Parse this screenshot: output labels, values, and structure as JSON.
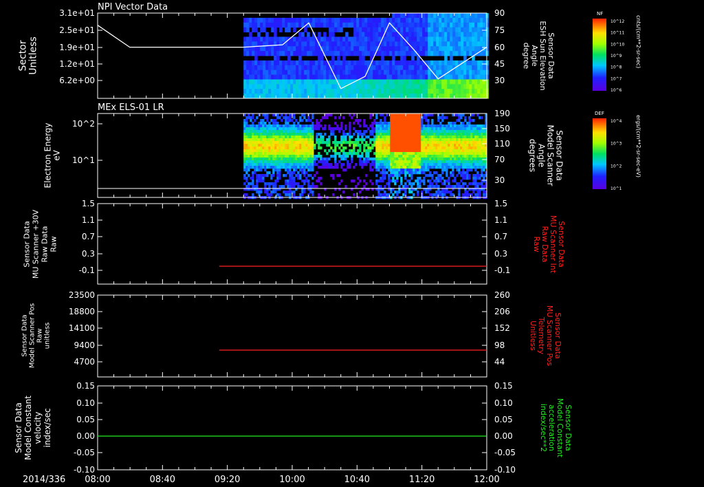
{
  "colors": {
    "bg": "#000000",
    "axis": "#ffffff",
    "red": "#ff2020",
    "green": "#22ee22"
  },
  "time_axis": {
    "date_label": "2014/336",
    "ticks": [
      "08:00",
      "08:40",
      "09:20",
      "10:00",
      "10:40",
      "11:20",
      "12:00"
    ]
  },
  "colorbars": [
    {
      "label": "NF",
      "unit": "cnts/(cm**2-sr-sec)",
      "tick_labels": [
        "10^12",
        "10^11",
        "10^10",
        "10^9",
        "10^8",
        "10^7",
        "10^6"
      ]
    },
    {
      "label": "DEF",
      "unit": "ergs/(cm**2-sr-sec-eV)",
      "tick_labels": [
        "10^4",
        "10^3",
        "10^2",
        "10^1"
      ]
    }
  ],
  "chart_data": [
    {
      "type": "heatmap",
      "title": "NPI Vector Data",
      "ylabel_lines": [
        "Sector",
        "Unitless"
      ],
      "y_ticks": [
        "3.1e+01",
        "2.5e+01",
        "1.9e+01",
        "1.2e+01",
        "6.2e+00"
      ],
      "y2label_lines": [
        "Sensor Data",
        "ESH Sun Elevation",
        "Angle",
        "degree"
      ],
      "y2_ticks": [
        "90",
        "75",
        "60",
        "45",
        "30"
      ],
      "data_start": "09:30",
      "overlay_line": {
        "name": "ESH Sun Elevation Angle",
        "t": [
          8.0,
          8.33,
          9.0,
          9.5,
          9.9,
          10.17,
          10.5,
          10.75,
          11.0,
          11.25,
          11.5,
          12.0
        ],
        "v": [
          80,
          62,
          62,
          62,
          64,
          82,
          28,
          38,
          82,
          60,
          36,
          62
        ]
      }
    },
    {
      "type": "heatmap",
      "title": "MEx ELS-01 LR",
      "ylabel_lines": [
        "Electron Energy",
        "eV"
      ],
      "y_ticks": [
        "10^2",
        "10^1"
      ],
      "y2label_lines": [
        "Sensor Data",
        "Model Scanner",
        "Angle",
        "degrees"
      ],
      "y2_ticks": [
        "190",
        "150",
        "110",
        "70",
        "30"
      ],
      "data_start": "09:30",
      "overlay_line": {
        "name": "Model Scanner Angle",
        "t": [
          8.0,
          12.0
        ],
        "v": [
          12,
          12
        ]
      }
    },
    {
      "type": "line",
      "ylabel_lines": [
        "Sensor Data",
        "MU Scanner +30V",
        "Raw Data",
        "Raw"
      ],
      "y_ticks": [
        "1.5",
        "1.1",
        "0.7",
        "0.3",
        "-0.1"
      ],
      "y2label_lines": [
        "Sensor Data",
        "MU Scanner Int",
        "Raw Data",
        "Raw"
      ],
      "y2_ticks": [
        "1.5",
        "1.1",
        "0.7",
        "0.3",
        "-0.1"
      ],
      "series": [
        {
          "t": [
            9.25,
            12.0
          ],
          "v": [
            0.0,
            0.0
          ]
        }
      ]
    },
    {
      "type": "line",
      "ylabel_lines": [
        "Sensor Data",
        "Model Scanner Pos",
        "Raw",
        "unitless"
      ],
      "y_ticks": [
        "23500",
        "18800",
        "14100",
        "9400",
        "4700"
      ],
      "y2label_lines": [
        "Sensor Data",
        "MU Scanner Pos",
        "Telemetry",
        "Unitless"
      ],
      "y2_ticks": [
        "260",
        "206",
        "152",
        "98",
        "44"
      ],
      "series": [
        {
          "t": [
            9.25,
            12.0
          ],
          "v": [
            7050,
            7050
          ]
        }
      ]
    },
    {
      "type": "line",
      "ylabel_lines": [
        "Sensor Data",
        "Model Constant",
        "velocity",
        "index/sec"
      ],
      "y_ticks": [
        "0.15",
        "0.10",
        "0.05",
        "0.00",
        "-0.05",
        "-0.10"
      ],
      "y2label_lines": [
        "Sensor Data",
        "Model Constant",
        "acceleration",
        "index/sec**2"
      ],
      "y2_ticks": [
        "0.15",
        "0.10",
        "0.05",
        "0.00",
        "-0.05",
        "-0.10"
      ],
      "series": [
        {
          "t": [
            8.0,
            12.0
          ],
          "v": [
            0.0,
            0.0
          ]
        }
      ]
    }
  ]
}
